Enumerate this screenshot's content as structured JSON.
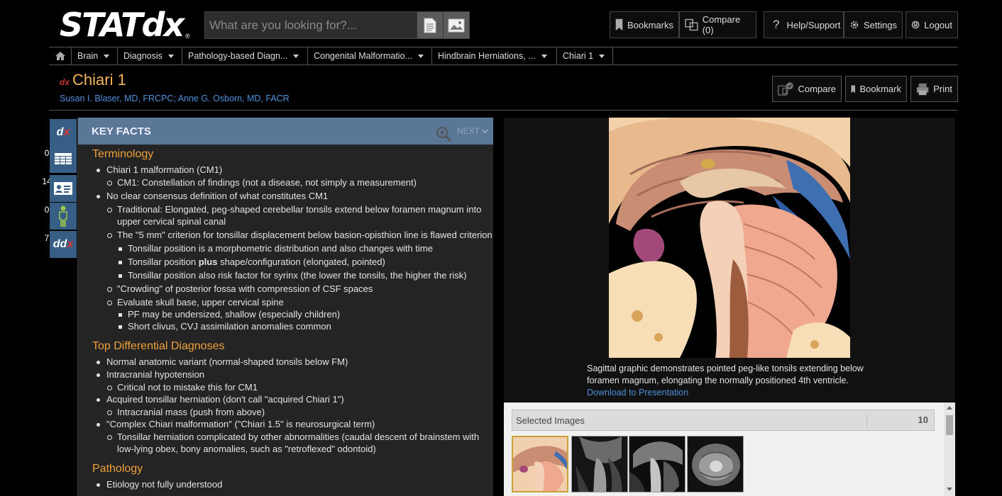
{
  "header": {
    "logo_text": "STATdx",
    "logo_reg": "®",
    "search_placeholder": "What are you looking for?...",
    "bookmarks_label": "Bookmarks",
    "compare_label": "Compare (0)",
    "help_label": "Help/Support",
    "settings_label": "Settings",
    "logout_label": "Logout"
  },
  "breadcrumb": [
    {
      "label": "Brain"
    },
    {
      "label": "Diagnosis"
    },
    {
      "label": "Pathology-based Diagn..."
    },
    {
      "label": "Congenital Malformatio..."
    },
    {
      "label": "Hindbrain Herniations, ..."
    },
    {
      "label": "Chiari 1"
    }
  ],
  "document": {
    "dx_mark": "dx",
    "title": "Chiari 1",
    "authors": "Susan I. Blaser, MD, FRCPC; Anne G. Osborn, MD, FACR",
    "compare_label": "Compare",
    "bookmark_label": "Bookmark",
    "print_label": "Print"
  },
  "rail": {
    "items": [
      {
        "name": "dx",
        "count": ""
      },
      {
        "name": "table",
        "count": "0"
      },
      {
        "name": "card",
        "count": "14"
      },
      {
        "name": "person",
        "count": "0"
      },
      {
        "name": "ddx",
        "count": "7"
      }
    ]
  },
  "key_facts": {
    "heading": "KEY FACTS",
    "next_label": "NEXT",
    "terminology": {
      "heading": "Terminology",
      "items": [
        "Chiari 1 malformation (CM1)",
        "CM1: Constellation of findings (not a disease, not simply a measurement)",
        "No clear consensus definition of what constitutes CM1",
        "Traditional: Elongated, peg-shaped cerebellar tonsils extend below foramen magnum into upper cervical spinal canal",
        "The \"5 mm\" criterion for tonsillar displacement below basion-opisthion line is flawed criterion",
        "Tonsillar position is a morphometric distribution and also changes with time",
        "Tonsillar position",
        "plus",
        " shape/configuration (elongated, pointed)",
        "Tonsillar position also risk factor for syrinx (the lower the tonsils, the higher the risk)",
        "\"Crowding\" of posterior fossa with compression of CSF spaces",
        "Evaluate skull base, upper cervical spine",
        "PF may be undersized, shallow (especially children)",
        "Short clivus, CVJ assimilation anomalies common"
      ]
    },
    "differential": {
      "heading": "Top Differential Diagnoses",
      "items": [
        "Normal anatomic variant (normal-shaped tonsils below FM)",
        "Intracranial hypotension",
        "Critical not to mistake this for CM1",
        "Acquired tonsillar herniation (don't call \"acquired Chiari 1\")",
        "Intracranial mass (push from above)",
        "\"Complex Chiari malformation\" (\"Chiari 1.5\" is neurosurgical term)",
        "Tonsillar herniation complicated by other abnormalities (caudal descent of brainstem with low-lying obex, bony anomalies, such as \"retroflexed\" odontoid)"
      ]
    },
    "pathology": {
      "heading": "Pathology",
      "items": [
        "Etiology not fully understood"
      ]
    }
  },
  "figure": {
    "caption": "Sagittal graphic demonstrates pointed peg-like tonsils extending below foramen magnum, elongating the normally positioned 4th ventricle.",
    "download_label": "Download to Presentation"
  },
  "selected_images": {
    "label": "Selected Images",
    "count": "10"
  }
}
